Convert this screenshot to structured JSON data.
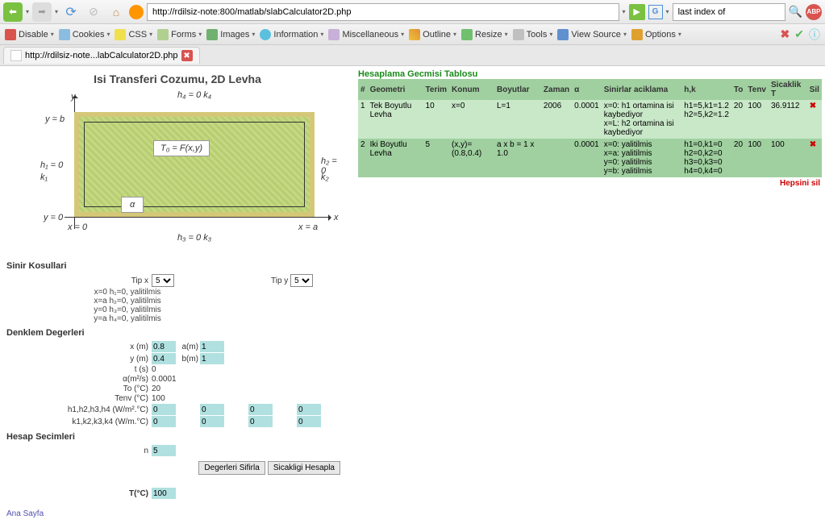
{
  "browser": {
    "url": "http://rdilsiz-note:800/matlab/slabCalculator2D.php",
    "search_value": "last index of",
    "search_engine": "G",
    "abp": "ABP"
  },
  "dev_toolbar": {
    "disable": "Disable",
    "cookies": "Cookies",
    "css": "CSS",
    "forms": "Forms",
    "images": "Images",
    "information": "Information",
    "miscellaneous": "Miscellaneous",
    "outline": "Outline",
    "resize": "Resize",
    "tools": "Tools",
    "view_source": "View Source",
    "options": "Options"
  },
  "tab": {
    "title": "http://rdilsiz-note...labCalculator2D.php"
  },
  "page": {
    "title": "Isi Transferi Cozumu, 2D Levha",
    "diagram": {
      "h4": "h₄ = 0  k₄",
      "yb": "y = b",
      "h1": "h₁ = 0",
      "k1": "k₁",
      "h2": "h₂ = 0",
      "k2": "k₂",
      "y0": "y = 0",
      "x0": "x = 0",
      "xa": "x = a",
      "h3": "h₃ = 0  k₃",
      "eq": "T₀ = F(x,y)",
      "alpha": "α",
      "x_axis": "x",
      "y_axis": "y"
    },
    "sections": {
      "sinir": "Sinir Kosullari",
      "denklem": "Denklem Degerleri",
      "hesap": "Hesap Secimleri"
    },
    "tipx_label": "Tip x",
    "tipx_value": "5",
    "tipy_label": "Tip y",
    "tipy_value": "5",
    "bc_lines": [
      "x=0  h₁=0, yalitilmis",
      "x=a  h₂=0, yalitilmis",
      "y=0  h₃=0, yalitilmis",
      "y=a  h₄=0, yalitilmis"
    ],
    "eq_rows": [
      {
        "label": "x (m)",
        "v1": "0.8",
        "label2": "a(m)",
        "v2": "1"
      },
      {
        "label": "y (m)",
        "v1": "0.4",
        "label2": "b(m)",
        "v2": "1"
      },
      {
        "label": "t (s)",
        "v1": "0"
      },
      {
        "label": "α(m²/s)",
        "v1": "0.0001"
      },
      {
        "label": "To (°C)",
        "v1": "20"
      },
      {
        "label": "Tenv (°C)",
        "v1": "100"
      },
      {
        "label": "h1,h2,h3,h4 (W/m².°C)",
        "v1": "0",
        "v2": "0",
        "v3": "0",
        "v4": "0"
      },
      {
        "label": "k1,k2,k3,k4 (W/m.°C)",
        "v1": "0",
        "v2": "0",
        "v3": "0",
        "v4": "0"
      }
    ],
    "n_label": "n",
    "n_value": "5",
    "btn_reset": "Degerleri Sifirla",
    "btn_calc": "Sicakligi Hesapla",
    "result_label": "T(°C)",
    "result_value": "100",
    "home_link": "Ana Sayfa"
  },
  "history": {
    "title": "Hesaplama Gecmisi Tablosu",
    "headers": [
      "#",
      "Geometri",
      "Terim",
      "Konum",
      "Boyutlar",
      "Zaman",
      "α",
      "Sinirlar aciklama",
      "h,k",
      "To",
      "Tenv",
      "Sicaklik T",
      "Sil"
    ],
    "rows": [
      {
        "n": "1",
        "geo": "Tek Boyutlu Levha",
        "terim": "10",
        "konum": "x=0",
        "boyut": "L=1",
        "zaman": "2006",
        "alpha": "0.0001",
        "sinir": "x=0: h1 ortamina isi kaybediyor\nx=L: h2 ortamina isi kaybediyor",
        "hk": "h1=5,k1=1.2\nh2=5,k2=1.2",
        "to": "20",
        "tenv": "100",
        "t": "36.9112"
      },
      {
        "n": "2",
        "geo": "Iki Boyutlu Levha",
        "terim": "5",
        "konum": "(x,y)=(0.8,0.4)",
        "boyut": "a x b = 1 x 1.0",
        "zaman": "",
        "alpha": "0.0001",
        "sinir": "x=0: yalitilmis\nx=a: yalitilmis\ny=0: yalitilmis\ny=b: yalitilmis",
        "hk": "h1=0,k1=0\nh2=0,k2=0\nh3=0,k3=0\nh4=0,k4=0",
        "to": "20",
        "tenv": "100",
        "t": "100"
      }
    ],
    "delete_all": "Hepsini sil"
  }
}
